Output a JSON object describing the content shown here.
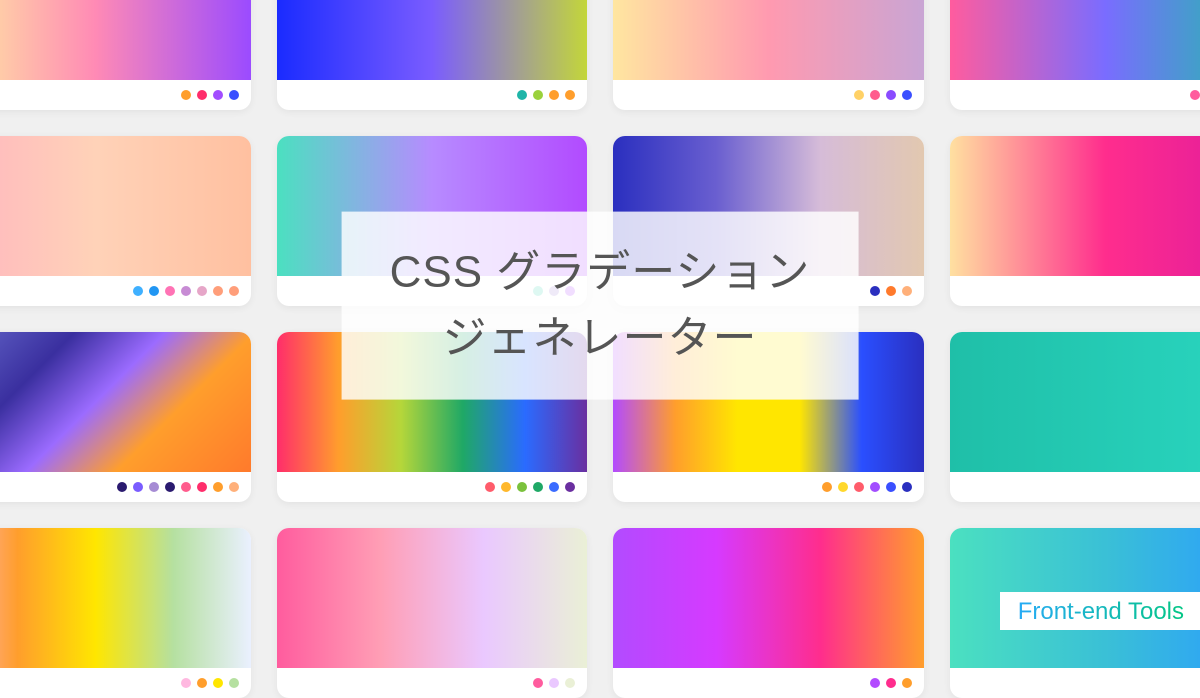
{
  "title": {
    "line1": "CSS グラデーション",
    "line2": "ジェネレーター"
  },
  "brand": "Front-end Tools",
  "cards": [
    {
      "gradient": "linear-gradient(90deg,#fff3a0,#ff8ab5,#9b4bff)",
      "dots": [
        "#ff9e2c",
        "#ff2d6b",
        "#a24dff",
        "#3a4fff"
      ]
    },
    {
      "gradient": "linear-gradient(90deg,#1a2bff,#7a5cff,#c3d63a)",
      "dots": [
        "#1fb5a8",
        "#9ad13c",
        "#ff9e2c",
        "#ff9e2c"
      ]
    },
    {
      "gradient": "linear-gradient(90deg,#ffe6a0,#ff9ab0,#c9a5d4)",
      "dots": [
        "#ffd166",
        "#ff5c8d",
        "#8a4bff",
        "#3a4fff"
      ]
    },
    {
      "gradient": "linear-gradient(90deg,#ff5c9e,#7a6cff,#1fbfa8)",
      "dots": [
        "#ff5c9e",
        "#7a6cff",
        "#1fbfa8",
        "#3a9cff"
      ]
    },
    {
      "gradient": "linear-gradient(90deg,#ffb3c0,#ffd2b8,#ffc0a0)",
      "dots": [
        "#3fb0ff",
        "#2196f3",
        "#ff73b5",
        "#c78bd4",
        "#e6a6c8",
        "#ff9e7a",
        "#ff9e7a"
      ]
    },
    {
      "gradient": "linear-gradient(90deg,#4be0c0,#b78bff,#b24bff)",
      "dots": [
        "#48d6b7",
        "#a68bd9",
        "#b24bff"
      ]
    },
    {
      "gradient": "linear-gradient(90deg,#2a2fbf,#6a5fd0,#d6bcd8,#e2c8b0)",
      "dots": [
        "#2a2fbf",
        "#ff7a2c",
        "#ffb07a"
      ]
    },
    {
      "gradient": "linear-gradient(90deg,#ffe0a0,#ff2d8d,#e01b9d)",
      "dots": [
        "#d6d0c4",
        "#ff2d8d"
      ]
    },
    {
      "gradient": "linear-gradient(135deg,#6a6fd0,#3a2f9f 30%,#9b6bff 50%,#ff9e2c 70%,#ff7a2c)",
      "dots": [
        "#2a1a6f",
        "#7a5cff",
        "#a68bd4",
        "#2a1a6f",
        "#ff5c8d",
        "#ff2d6b",
        "#ff9e2c",
        "#ffb07a"
      ]
    },
    {
      "gradient": "linear-gradient(90deg,#ff2d6b,#ff9e2c,#b5d63a,#1fa866,#2a6bff,#6a2fa0)",
      "dots": [
        "#ff5c6b",
        "#ffb82c",
        "#7ac13c",
        "#1fa866",
        "#3a6bff",
        "#6a2fa0"
      ]
    },
    {
      "gradient": "linear-gradient(90deg,#b24bff,#ff9e2c,#ffe600,#ffe600,#2a4fff,#2a2fbf)",
      "dots": [
        "#ff9e2c",
        "#ffd82c",
        "#ff5c6b",
        "#a24dff",
        "#3a4fff",
        "#2a2fbf"
      ]
    },
    {
      "gradient": "linear-gradient(90deg,#1fbfa8,#2ad6c0)",
      "dots": [
        "#1fbfa8",
        "#2ad6c0"
      ]
    },
    {
      "gradient": "linear-gradient(90deg,#ffb8e0,#ff9e2c,#ffe600,#b5e0a0,#eaf0ff)",
      "dots": [
        "#ffb8e0",
        "#ff9e2c",
        "#ffe600",
        "#b5e0a0"
      ]
    },
    {
      "gradient": "linear-gradient(90deg,#ff5c9e,#ff9eb5,#eac8ff,#eaf0d6)",
      "dots": [
        "#ff5c9e",
        "#eac8ff",
        "#eaf0d6"
      ]
    },
    {
      "gradient": "linear-gradient(90deg,#b24bff,#d63aff,#ff2d8d,#ff9e2c)",
      "dots": [
        "#b24bff",
        "#ff2d8d",
        "#ff9e2c"
      ]
    },
    {
      "gradient": "linear-gradient(90deg,#4be0c0,#3ac0d6,#2a9cff)",
      "dots": [
        "#4be0c0",
        "#2a9cff"
      ]
    }
  ]
}
